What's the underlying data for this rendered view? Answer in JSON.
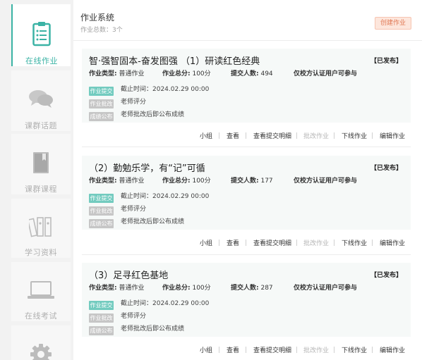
{
  "sidebar": {
    "items": [
      {
        "label": "在线作业",
        "icon": "clipboard-icon",
        "active": true
      },
      {
        "label": "课群话题",
        "icon": "chat-bubbles-icon"
      },
      {
        "label": "课群课程",
        "icon": "book-icon"
      },
      {
        "label": "学习资料",
        "icon": "binders-icon"
      },
      {
        "label": "在线考试",
        "icon": "laptop-icon"
      },
      {
        "label": "",
        "icon": "gear-icon"
      }
    ]
  },
  "header": {
    "title": "作业系统",
    "total": "作业总数：3个",
    "create_label": "创建作业"
  },
  "meta_labels": {
    "type": "作业类型:",
    "score": "作业总分:",
    "submit": "提交人数:",
    "restriction": "仅校方认证用户可参与"
  },
  "assignments": [
    {
      "title": "智·强智固本-奋发图强 （1）研读红色经典",
      "status": "【已发布】",
      "type": "普通作业",
      "score": "100分",
      "submit_count": "494",
      "steps": [
        {
          "tag": "作业提交",
          "text": "截止时间：2024.02.29 00:00",
          "active": true
        },
        {
          "tag": "作业批改",
          "text": "老师评分"
        },
        {
          "tag": "成绩公布",
          "text": "老师批改后即公布成绩"
        }
      ]
    },
    {
      "title": "（2）勤勉乐学，有“记”可循",
      "status": "【已发布】",
      "type": "普通作业",
      "score": "100分",
      "submit_count": "177",
      "steps": [
        {
          "tag": "作业提交",
          "text": "截止时间：2024.02.29 00:00",
          "active": true
        },
        {
          "tag": "作业批改",
          "text": "老师评分"
        },
        {
          "tag": "成绩公布",
          "text": "老师批改后即公布成绩"
        }
      ]
    },
    {
      "title": "（3）足寻红色基地",
      "status": "【已发布】",
      "type": "普通作业",
      "score": "100分",
      "submit_count": "287",
      "steps": [
        {
          "tag": "作业提交",
          "text": "截止时间：2024.02.29 00:00",
          "active": true
        },
        {
          "tag": "作业批改",
          "text": "老师评分"
        },
        {
          "tag": "成绩公布",
          "text": "老师批改后即公布成绩"
        }
      ]
    }
  ],
  "actions": [
    "小组",
    "查看",
    "查看提交明细",
    "批改作业",
    "下线作业",
    "编辑作业"
  ],
  "colors": {
    "accent": "#3bb3a5",
    "tag_active": "#72cbbf",
    "tag_inactive": "#c6c6c6",
    "create_bg": "#fde6dc",
    "create_text": "#e07854"
  }
}
